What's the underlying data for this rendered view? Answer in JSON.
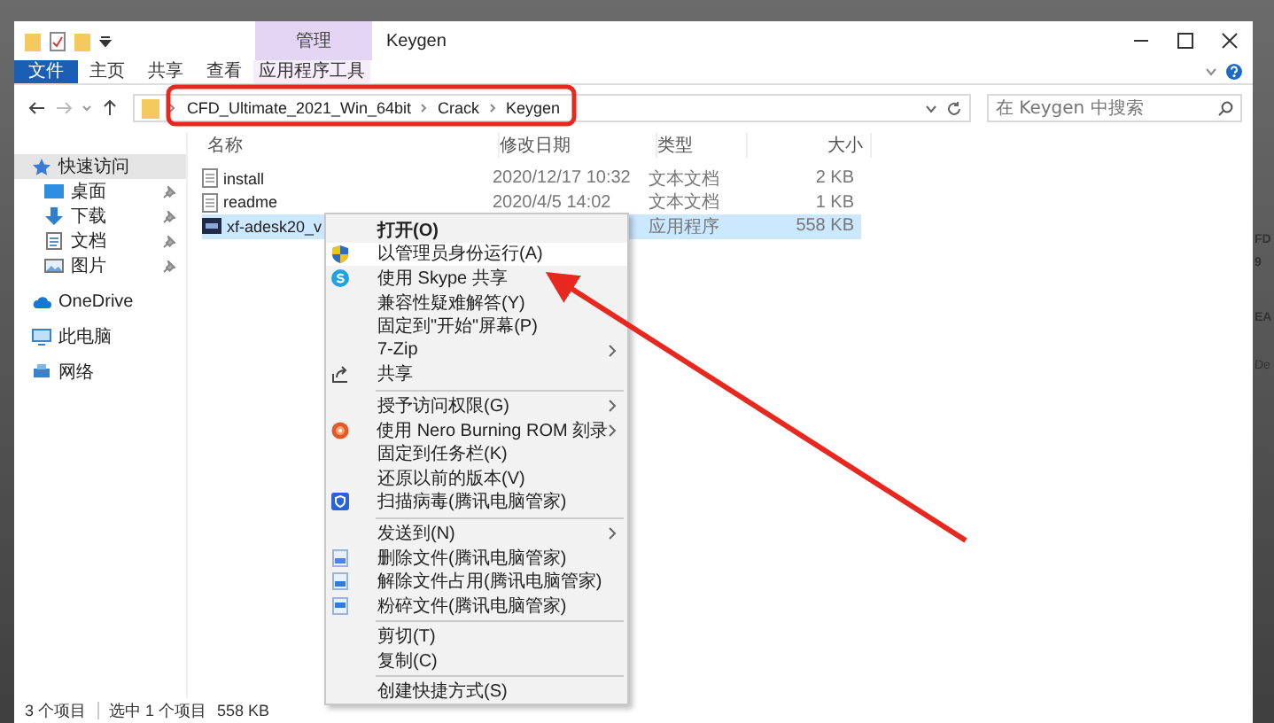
{
  "window": {
    "title": "Keygen",
    "context_tab": "管理"
  },
  "ribbon_tabs": [
    {
      "label": "文件",
      "kind": "file",
      "selected": false
    },
    {
      "label": "主页",
      "kind": "tab",
      "selected": false
    },
    {
      "label": "共享",
      "kind": "tab",
      "selected": false
    },
    {
      "label": "查看",
      "kind": "tab",
      "selected": false
    },
    {
      "label": "应用程序工具",
      "kind": "context",
      "selected": false
    }
  ],
  "address": {
    "path": [
      "CFD_Ultimate_2021_Win_64bit",
      "Crack",
      "Keygen"
    ]
  },
  "search": {
    "placeholder": "在 Keygen 中搜索"
  },
  "sidebar": {
    "items": [
      {
        "label": "快速访问",
        "kind": "star",
        "selected": true,
        "children": [
          {
            "label": "桌面",
            "kind": "desktop",
            "pinned": true
          },
          {
            "label": "下载",
            "kind": "download",
            "pinned": true
          },
          {
            "label": "文档",
            "kind": "document",
            "pinned": true
          },
          {
            "label": "图片",
            "kind": "picture",
            "pinned": true
          }
        ]
      },
      {
        "label": "OneDrive",
        "kind": "cloud",
        "selected": false
      },
      {
        "label": "此电脑",
        "kind": "pc",
        "selected": false
      },
      {
        "label": "网络",
        "kind": "network",
        "selected": false
      }
    ]
  },
  "table": {
    "columns": [
      "名称",
      "修改日期",
      "类型",
      "大小"
    ],
    "rows": [
      {
        "name": "install",
        "modified": "2020/12/17 10:32",
        "type": "文本文档",
        "size": "2 KB",
        "kind": "text",
        "selected": false
      },
      {
        "name": "readme",
        "modified": "2020/4/5 14:02",
        "type": "文本文档",
        "size": "1 KB",
        "kind": "text",
        "selected": false
      },
      {
        "name": "xf-adesk20_v",
        "type": "应用程序",
        "size": "558 KB",
        "kind": "app",
        "selected": true
      }
    ]
  },
  "context_menu": {
    "items": [
      {
        "kind": "plain",
        "label": "打开(O)",
        "default": true,
        "highlighted": false
      },
      {
        "kind": "admin",
        "label": "以管理员身份运行(A)",
        "default": false,
        "highlighted": true
      },
      {
        "kind": "skype",
        "label": "使用 Skype 共享",
        "default": false,
        "highlighted": false
      },
      {
        "kind": "plain",
        "label": "兼容性疑难解答(Y)",
        "default": false,
        "highlighted": false
      },
      {
        "kind": "plain",
        "label": "固定到\"开始\"屏幕(P)",
        "default": false,
        "highlighted": false
      },
      {
        "kind": "plain",
        "label": "7-Zip",
        "default": false,
        "highlighted": false,
        "submenu": true
      },
      {
        "kind": "share",
        "label": "共享",
        "default": false,
        "highlighted": false
      },
      {
        "kind": "separator"
      },
      {
        "kind": "plain",
        "label": "授予访问权限(G)",
        "default": false,
        "highlighted": false,
        "submenu": true
      },
      {
        "kind": "nero",
        "label": "使用 Nero Burning ROM 刻录",
        "default": false,
        "highlighted": false,
        "submenu": true
      },
      {
        "kind": "plain",
        "label": "固定到任务栏(K)",
        "default": false,
        "highlighted": false
      },
      {
        "kind": "plain",
        "label": "还原以前的版本(V)",
        "default": false,
        "highlighted": false
      },
      {
        "kind": "scan",
        "label": "扫描病毒(腾讯电脑管家)",
        "default": false,
        "highlighted": false
      },
      {
        "kind": "separator"
      },
      {
        "kind": "plain",
        "label": "发送到(N)",
        "default": false,
        "highlighted": false,
        "submenu": true
      },
      {
        "kind": "delete",
        "label": "删除文件(腾讯电脑管家)",
        "default": false,
        "highlighted": false
      },
      {
        "kind": "unlock",
        "label": "解除文件占用(腾讯电脑管家)",
        "default": false,
        "highlighted": false
      },
      {
        "kind": "shred",
        "label": "粉碎文件(腾讯电脑管家)",
        "default": false,
        "highlighted": false
      },
      {
        "kind": "separator"
      },
      {
        "kind": "plain",
        "label": "剪切(T)",
        "default": false,
        "highlighted": false
      },
      {
        "kind": "plain",
        "label": "复制(C)",
        "default": false,
        "highlighted": false
      },
      {
        "kind": "separator"
      },
      {
        "kind": "plain",
        "label": "创建快捷方式(S)",
        "default": false,
        "highlighted": false
      }
    ]
  },
  "status_bar": {
    "item_count": "3 个项目",
    "selection": "选中 1 个项目",
    "selection_size": "558 KB"
  },
  "background_window": {
    "lines": [
      "FD",
      "9",
      "EA",
      "De"
    ]
  }
}
